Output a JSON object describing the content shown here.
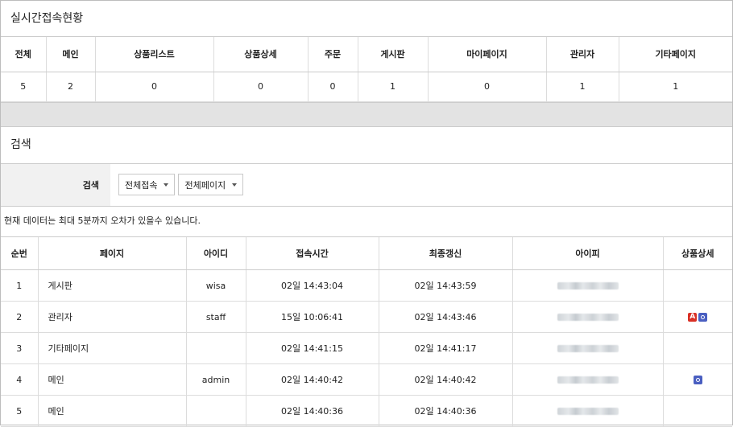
{
  "realtime": {
    "title": "실시간접속현황",
    "headers": [
      "전체",
      "메인",
      "상품리스트",
      "상품상세",
      "주문",
      "게시판",
      "마이페이지",
      "관리자",
      "기타페이지"
    ],
    "values": [
      "5",
      "2",
      "0",
      "0",
      "0",
      "1",
      "0",
      "1",
      "1"
    ]
  },
  "search": {
    "title": "검색",
    "label": "검색",
    "select_access": "전체접속",
    "select_page": "전체페이지"
  },
  "notice": "현재 데이터는 최대 5분까지 오차가 있을수 있습니다.",
  "list": {
    "headers": [
      "순번",
      "페이지",
      "아이디",
      "접속시간",
      "최종갱신",
      "아이피",
      "상품상세"
    ],
    "rows": [
      {
        "no": "1",
        "page": "게시판",
        "id": "wisa",
        "access": "02일 14:43:04",
        "updated": "02일 14:43:59",
        "badges": []
      },
      {
        "no": "2",
        "page": "관리자",
        "id": "staff",
        "access": "15일 10:06:41",
        "updated": "02일 14:43:46",
        "badges": [
          "A",
          "O"
        ]
      },
      {
        "no": "3",
        "page": "기타페이지",
        "id": "",
        "access": "02일 14:41:15",
        "updated": "02일 14:41:17",
        "badges": []
      },
      {
        "no": "4",
        "page": "메인",
        "id": "admin",
        "access": "02일 14:40:42",
        "updated": "02일 14:40:42",
        "badges": [
          "O"
        ]
      },
      {
        "no": "5",
        "page": "메인",
        "id": "",
        "access": "02일 14:40:36",
        "updated": "02일 14:40:36",
        "badges": []
      }
    ]
  },
  "colors": {
    "badge_admin": "#d93025",
    "badge_detail": "#4a5fc1",
    "band": "#e3e3e3"
  }
}
